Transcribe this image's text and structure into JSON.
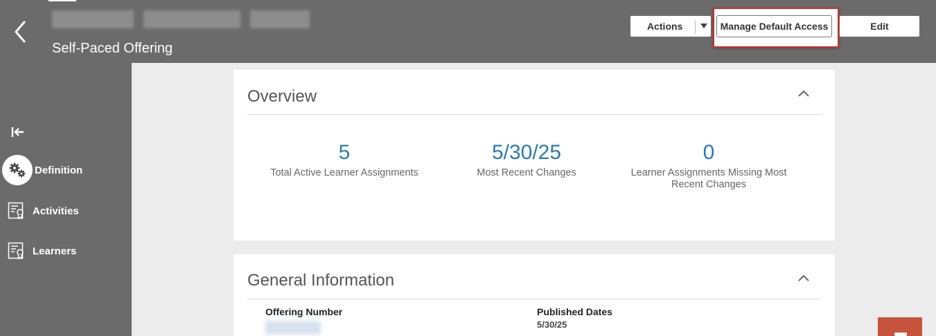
{
  "header": {
    "subtitle": "Self-Paced Offering",
    "back_icon": "chevron-left-icon"
  },
  "toolbar": {
    "actions_label": "Actions",
    "manage_default_access_label": "Manage Default Access",
    "edit_label": "Edit",
    "highlight_color": "#d12b2b"
  },
  "sidebar": {
    "collapse_icon": "collapse-left-icon",
    "items": [
      {
        "label": "Definition",
        "icon": "gears-icon",
        "selected": true
      },
      {
        "label": "Activities",
        "icon": "document-certificate-icon",
        "selected": false
      },
      {
        "label": "Learners",
        "icon": "document-certificate-icon",
        "selected": false
      }
    ]
  },
  "overview": {
    "title": "Overview",
    "metrics": [
      {
        "value": "5",
        "label": "Total Active Learner Assignments"
      },
      {
        "value": "5/30/25",
        "label": "Most Recent Changes"
      },
      {
        "value": "0",
        "label": "Learner Assignments Missing Most Recent Changes"
      }
    ]
  },
  "general_information": {
    "title": "General Information",
    "offering_number_label": "Offering Number",
    "published_dates_label": "Published Dates",
    "published_dates_value": "5/30/25"
  },
  "colors": {
    "header_bg": "#6b6b6b",
    "metric_value": "#2a7ab0",
    "fab": "#c7533c"
  }
}
